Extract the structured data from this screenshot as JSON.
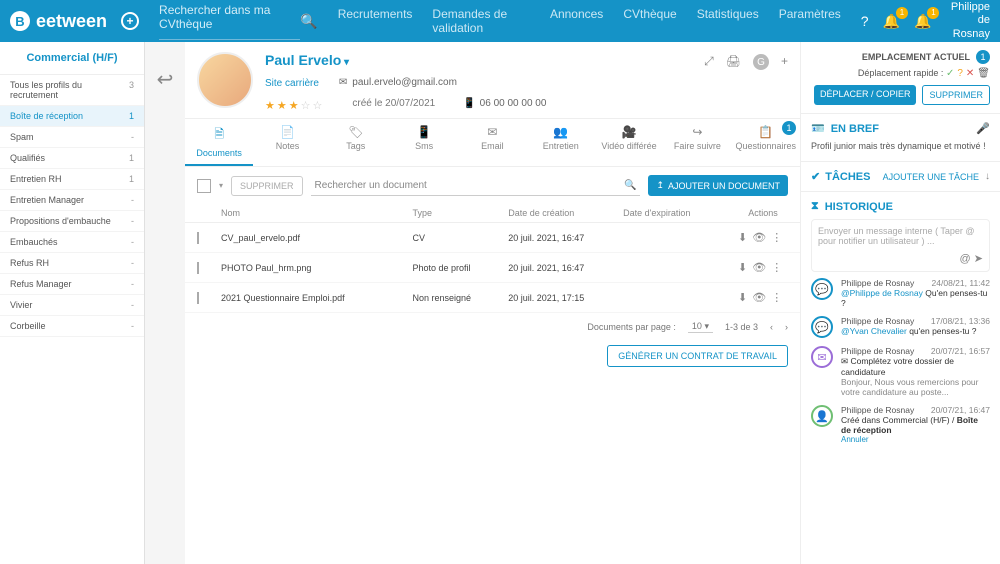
{
  "header": {
    "brand": "eetween",
    "search_placeholder": "Rechercher dans ma CVthèque",
    "nav": [
      "Recrutements",
      "Demandes de validation",
      "Annonces",
      "CVthèque",
      "Statistiques",
      "Paramètres"
    ],
    "notif_badge": "1",
    "user_first": "Philippe",
    "user_last": "de Rosnay"
  },
  "sidebar": {
    "title": "Commercial (H/F)",
    "items": [
      {
        "label": "Tous les profils du recrutement",
        "count": "3"
      },
      {
        "label": "Boîte de réception",
        "count": "1",
        "active": true
      },
      {
        "label": "Spam",
        "count": "-"
      },
      {
        "label": "Qualifiés",
        "count": "1"
      },
      {
        "label": "Entretien RH",
        "count": "1"
      },
      {
        "label": "Entretien Manager",
        "count": "-"
      },
      {
        "label": "Propositions d'embauche",
        "count": "-"
      },
      {
        "label": "Embauchés",
        "count": "-"
      },
      {
        "label": "Refus RH",
        "count": "-"
      },
      {
        "label": "Refus Manager",
        "count": "-"
      },
      {
        "label": "Vivier",
        "count": "-"
      },
      {
        "label": "Corbeille",
        "count": "-"
      }
    ]
  },
  "profile": {
    "name": "Paul Ervelo",
    "site": "Site carrière",
    "email": "paul.ervelo@gmail.com",
    "created": "créé le 20/07/2021",
    "phone": "06 00 00 00 00"
  },
  "tabs": {
    "items": [
      "Documents",
      "Notes",
      "Tags",
      "Sms",
      "Email",
      "Entretien",
      "Vidéo différée",
      "Faire suivre",
      "Questionnaires"
    ],
    "badge": "1"
  },
  "toolbar": {
    "delete": "SUPPRIMER",
    "search_placeholder": "Rechercher un document",
    "add": "AJOUTER UN DOCUMENT"
  },
  "table": {
    "headers": {
      "name": "Nom",
      "type": "Type",
      "created": "Date de création",
      "exp": "Date d'expiration",
      "actions": "Actions"
    },
    "rows": [
      {
        "name": "CV_paul_ervelo.pdf",
        "type": "CV",
        "created": "20 juil. 2021, 16:47",
        "exp": ""
      },
      {
        "name": "PHOTO Paul_hrm.png",
        "type": "Photo de profil",
        "created": "20 juil. 2021, 16:47",
        "exp": ""
      },
      {
        "name": "2021 Questionnaire Emploi.pdf",
        "type": "Non renseigné",
        "created": "20 juil. 2021, 17:15",
        "exp": ""
      }
    ]
  },
  "pagination": {
    "label": "Documents par page :",
    "per": "10",
    "range": "1-3 de 3"
  },
  "generate": "GÉNÉRER UN CONTRAT DE TRAVAIL",
  "right": {
    "location_label": "EMPLACEMENT ACTUEL",
    "location_count": "1",
    "quick_move": "Déplacement rapide :",
    "move_copy": "DÉPLACER / COPIER",
    "delete": "SUPPRIMER",
    "brief_title": "EN BREF",
    "brief_text": "Profil junior mais très dynamique et motivé !",
    "tasks_title": "TÂCHES",
    "tasks_add": "AJOUTER UNE TÂCHE",
    "history_title": "HISTORIQUE",
    "msg_placeholder": "Envoyer un message interne ( Taper @ pour notifier un utilisateur ) ...",
    "timeline": [
      {
        "author": "Philippe de Rosnay",
        "time": "24/08/21, 11:42",
        "mention": "@Philippe de Rosnay",
        "text": "Qu'en penses-tu ?",
        "icon": "chat"
      },
      {
        "author": "Philippe de Rosnay",
        "time": "17/08/21, 13:36",
        "mention": "@Yvan Chevalier",
        "text": "qu'en penses-tu ?",
        "icon": "chat"
      },
      {
        "author": "Philippe de Rosnay",
        "time": "20/07/21, 16:57",
        "subject": "Complétez votre dossier de candidature",
        "body": "Bonjour, Nous vous remercions pour votre candidature au poste...",
        "icon": "mail"
      },
      {
        "author": "Philippe de Rosnay",
        "time": "20/07/21, 16:47",
        "creation": "Créé dans Commercial (H/F) / ",
        "creation_loc": "Boîte de réception",
        "cancel": "Annuler",
        "icon": "user"
      }
    ]
  }
}
